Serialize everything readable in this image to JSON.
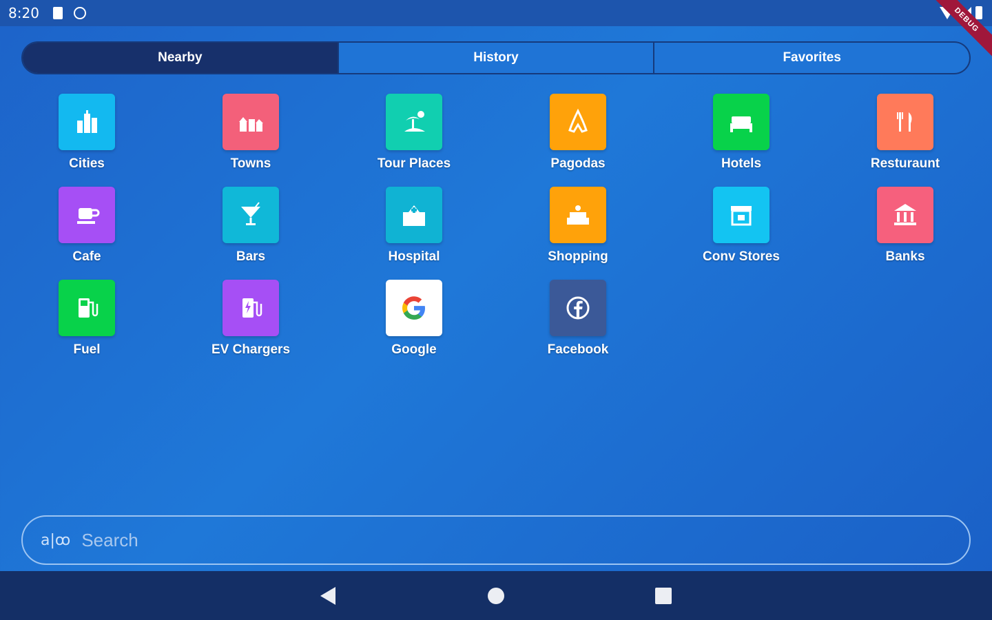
{
  "status_bar": {
    "time": "8:20",
    "icons": [
      "sd-card-icon",
      "no-sim-icon",
      "wifi-icon",
      "signal-icon",
      "battery-icon"
    ],
    "debug_banner": "DEBUG"
  },
  "tabs": [
    {
      "label": "Nearby",
      "active": true
    },
    {
      "label": "History",
      "active": false
    },
    {
      "label": "Favorites",
      "active": false
    }
  ],
  "categories": [
    {
      "label": "Cities",
      "icon": "city-icon",
      "color": "#13b9f0"
    },
    {
      "label": "Towns",
      "icon": "town-icon",
      "color": "#f3607a"
    },
    {
      "label": "Tour Places",
      "icon": "beach-icon",
      "color": "#11cfb0"
    },
    {
      "label": "Pagodas",
      "icon": "pagoda-icon",
      "color": "#ffa20a"
    },
    {
      "label": "Hotels",
      "icon": "bed-icon",
      "color": "#08d24a"
    },
    {
      "label": "Resturaunt",
      "icon": "fork-knife-icon",
      "color": "#ff7a5a"
    },
    {
      "label": "Cafe",
      "icon": "coffee-icon",
      "color": "#a64ff5"
    },
    {
      "label": "Bars",
      "icon": "cocktail-icon",
      "color": "#10b8d8"
    },
    {
      "label": "Hospital",
      "icon": "hospital-icon",
      "color": "#10b3d3"
    },
    {
      "label": "Shopping",
      "icon": "mall-icon",
      "color": "#ffa20a"
    },
    {
      "label": "Conv Stores",
      "icon": "store-icon",
      "color": "#13c4f2"
    },
    {
      "label": "Banks",
      "icon": "bank-icon",
      "color": "#f6607d"
    },
    {
      "label": "Fuel",
      "icon": "fuel-pump-icon",
      "color": "#08d24a"
    },
    {
      "label": "EV Chargers",
      "icon": "ev-charger-icon",
      "color": "#a64ff5"
    },
    {
      "label": "Google",
      "icon": "google-icon",
      "color": "#ffffff"
    },
    {
      "label": "Facebook",
      "icon": "facebook-icon",
      "color": "#3b5998"
    }
  ],
  "search": {
    "icon_text": "a|ꝏ",
    "placeholder": "Search"
  },
  "nav_bar": {
    "buttons": [
      "back-icon",
      "home-icon",
      "recents-icon"
    ]
  }
}
